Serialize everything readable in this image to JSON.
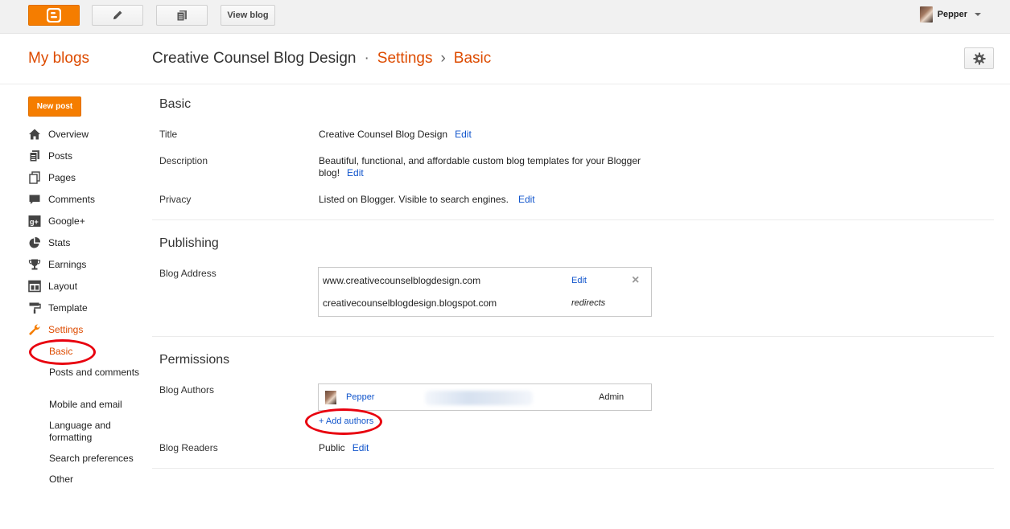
{
  "topbar": {
    "view_blog_label": "View blog",
    "user_name": "Pepper",
    "blogger_color": "#f57d00"
  },
  "header": {
    "my_blogs": "My blogs",
    "blog_name": "Creative Counsel Blog Design",
    "sep1": "·",
    "settings": "Settings",
    "sep2": "›",
    "basic": "Basic"
  },
  "sidebar": {
    "new_post": "New post",
    "items": [
      {
        "label": "Overview",
        "icon": "home-icon"
      },
      {
        "label": "Posts",
        "icon": "posts-icon"
      },
      {
        "label": "Pages",
        "icon": "pages-icon"
      },
      {
        "label": "Comments",
        "icon": "comments-icon"
      },
      {
        "label": "Google+",
        "icon": "google-plus-icon"
      },
      {
        "label": "Stats",
        "icon": "stats-icon"
      },
      {
        "label": "Earnings",
        "icon": "trophy-icon"
      },
      {
        "label": "Layout",
        "icon": "layout-icon"
      },
      {
        "label": "Template",
        "icon": "paint-roller-icon"
      },
      {
        "label": "Settings",
        "icon": "wrench-icon"
      }
    ],
    "subitems": [
      {
        "label": "Basic"
      },
      {
        "label": "Posts and comments"
      },
      {
        "label": "Mobile and email"
      },
      {
        "label": "Language and formatting"
      },
      {
        "label": "Search preferences"
      },
      {
        "label": "Other"
      }
    ]
  },
  "basic": {
    "heading": "Basic",
    "title_label": "Title",
    "title_value": "Creative Counsel Blog Design",
    "description_label": "Description",
    "description_value": "Beautiful, functional, and affordable custom blog templates for your Blogger blog!",
    "privacy_label": "Privacy",
    "privacy_value": "Listed on Blogger. Visible to search engines.",
    "edit": "Edit"
  },
  "publishing": {
    "heading": "Publishing",
    "address_label": "Blog Address",
    "custom_domain": "www.creativecounselblogdesign.com",
    "blogspot_domain": "creativecounselblogdesign.blogspot.com",
    "edit": "Edit",
    "redirects": "redirects"
  },
  "permissions": {
    "heading": "Permissions",
    "authors_label": "Blog Authors",
    "author_name": "Pepper",
    "author_role": "Admin",
    "add_authors": "+ Add authors",
    "readers_label": "Blog Readers",
    "readers_value": "Public",
    "edit": "Edit"
  },
  "colors": {
    "accent": "#dd4b00",
    "link": "#1155cc",
    "annotation_ring": "#e8000e"
  }
}
